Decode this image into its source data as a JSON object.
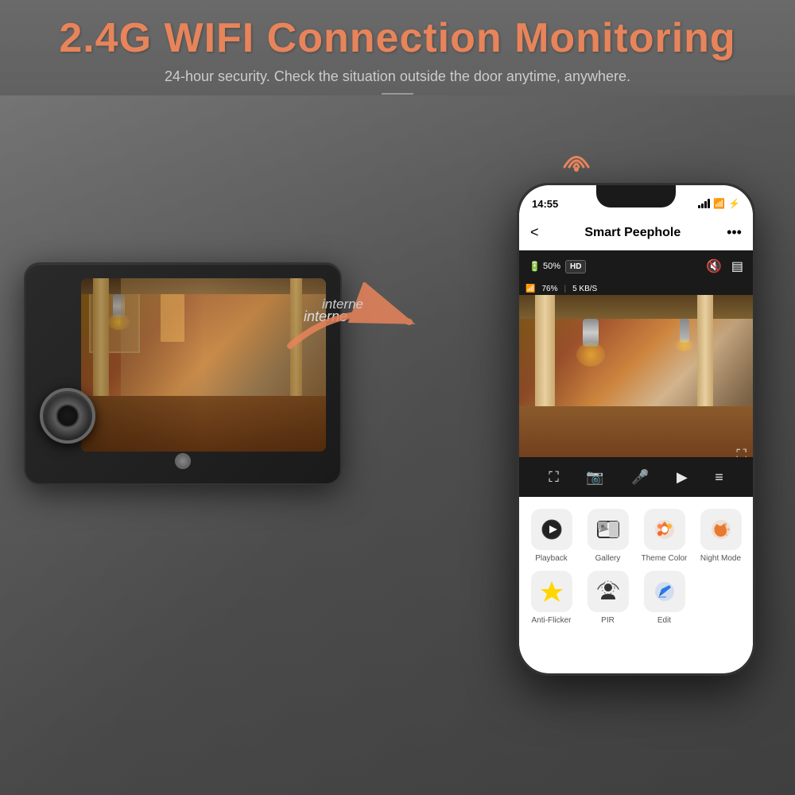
{
  "page": {
    "bg_color": "#555555"
  },
  "header": {
    "main_title": "2.4G WIFI Connection Monitoring",
    "sub_title": "24-hour security. Check the situation outside the door anytime, anywhere.",
    "divider": true
  },
  "arrow_label": "interne",
  "phone": {
    "status_bar": {
      "time": "14:55",
      "signal": "●●●",
      "wifi": "wifi",
      "battery": "⚡"
    },
    "app_header": {
      "back_icon": "<",
      "title": "Smart Peephole",
      "more_icon": "..."
    },
    "cam_controls": {
      "battery_pct": "50%",
      "hd_label": "HD",
      "wifi_pct": "76%",
      "speed": "5 KB/S"
    },
    "menu_items": [
      {
        "id": "playback",
        "label": "Playback",
        "icon": "▶"
      },
      {
        "id": "gallery",
        "label": "Gallery",
        "icon": "🖼"
      },
      {
        "id": "theme",
        "label": "Theme Color",
        "icon": "🎨"
      },
      {
        "id": "night",
        "label": "Night Mode",
        "icon": "🌙"
      },
      {
        "id": "antiflicker",
        "label": "Anti-Flicker",
        "icon": "⚡"
      },
      {
        "id": "pir",
        "label": "PIR",
        "icon": "👁"
      },
      {
        "id": "edit",
        "label": "Edit",
        "icon": "✏"
      }
    ],
    "bottom_controls": [
      "⛶",
      "📷",
      "🎤",
      "▷",
      "≡"
    ]
  }
}
